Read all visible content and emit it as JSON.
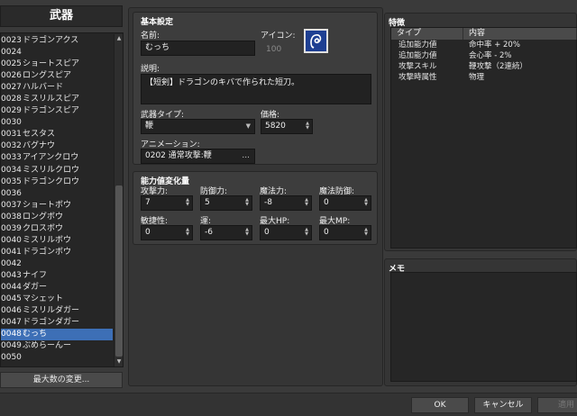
{
  "list": {
    "title": "武器",
    "items": [
      {
        "num": "0023",
        "name": "ドラゴンアクス"
      },
      {
        "num": "0024",
        "name": ""
      },
      {
        "num": "0025",
        "name": "ショートスピア"
      },
      {
        "num": "0026",
        "name": "ロングスピア"
      },
      {
        "num": "0027",
        "name": "ハルバード"
      },
      {
        "num": "0028",
        "name": "ミスリルスピア"
      },
      {
        "num": "0029",
        "name": "ドラゴンスピア"
      },
      {
        "num": "0030",
        "name": ""
      },
      {
        "num": "0031",
        "name": "セスタス"
      },
      {
        "num": "0032",
        "name": "バグナウ"
      },
      {
        "num": "0033",
        "name": "アイアンクロウ"
      },
      {
        "num": "0034",
        "name": "ミスリルクロウ"
      },
      {
        "num": "0035",
        "name": "ドラゴンクロウ"
      },
      {
        "num": "0036",
        "name": ""
      },
      {
        "num": "0037",
        "name": "ショートボウ"
      },
      {
        "num": "0038",
        "name": "ロングボウ"
      },
      {
        "num": "0039",
        "name": "クロスボウ"
      },
      {
        "num": "0040",
        "name": "ミスリルボウ"
      },
      {
        "num": "0041",
        "name": "ドラゴンボウ"
      },
      {
        "num": "0042",
        "name": ""
      },
      {
        "num": "0043",
        "name": "ナイフ"
      },
      {
        "num": "0044",
        "name": "ダガー"
      },
      {
        "num": "0045",
        "name": "マシェット"
      },
      {
        "num": "0046",
        "name": "ミスリルダガー"
      },
      {
        "num": "0047",
        "name": "ドラゴンダガー"
      },
      {
        "num": "0048",
        "name": "むっち"
      },
      {
        "num": "0049",
        "name": "ぶめらーんー"
      },
      {
        "num": "0050",
        "name": ""
      }
    ],
    "selected_index": 25,
    "max_button": "最大数の変更..."
  },
  "basic": {
    "title": "基本設定",
    "name_label": "名前:",
    "name_value": "むっち",
    "icon_label": "アイコン:",
    "icon_index": "100",
    "desc_label": "説明:",
    "desc_value": "【短剣】ドラゴンのキバで作られた短刀。",
    "type_label": "武器タイプ:",
    "type_value": "鞭",
    "price_label": "価格:",
    "price_value": "5820",
    "anim_label": "アニメーション:",
    "anim_value": "0202 通常攻撃:鞭",
    "dots": "..."
  },
  "params": {
    "title": "能力値変化量",
    "items": [
      {
        "label": "攻撃力:",
        "value": "7"
      },
      {
        "label": "防御力:",
        "value": "5"
      },
      {
        "label": "魔法力:",
        "value": "-8"
      },
      {
        "label": "魔法防御:",
        "value": "0"
      },
      {
        "label": "敏捷性:",
        "value": "0"
      },
      {
        "label": "運:",
        "value": "-6"
      },
      {
        "label": "最大HP:",
        "value": "0"
      },
      {
        "label": "最大MP:",
        "value": "0"
      }
    ]
  },
  "traits": {
    "title": "特徴",
    "col_type": "タイプ",
    "col_content": "内容",
    "rows": [
      {
        "type": "追加能力値",
        "content": "命中率 + 20%"
      },
      {
        "type": "追加能力値",
        "content": "会心率 - 2%"
      },
      {
        "type": "攻撃スキル",
        "content": "鞭攻撃（2連続）"
      },
      {
        "type": "攻撃時属性",
        "content": "物理"
      }
    ]
  },
  "memo": {
    "title": "メモ"
  },
  "buttons": {
    "ok": "OK",
    "cancel": "キャンセル",
    "apply": "適用"
  }
}
